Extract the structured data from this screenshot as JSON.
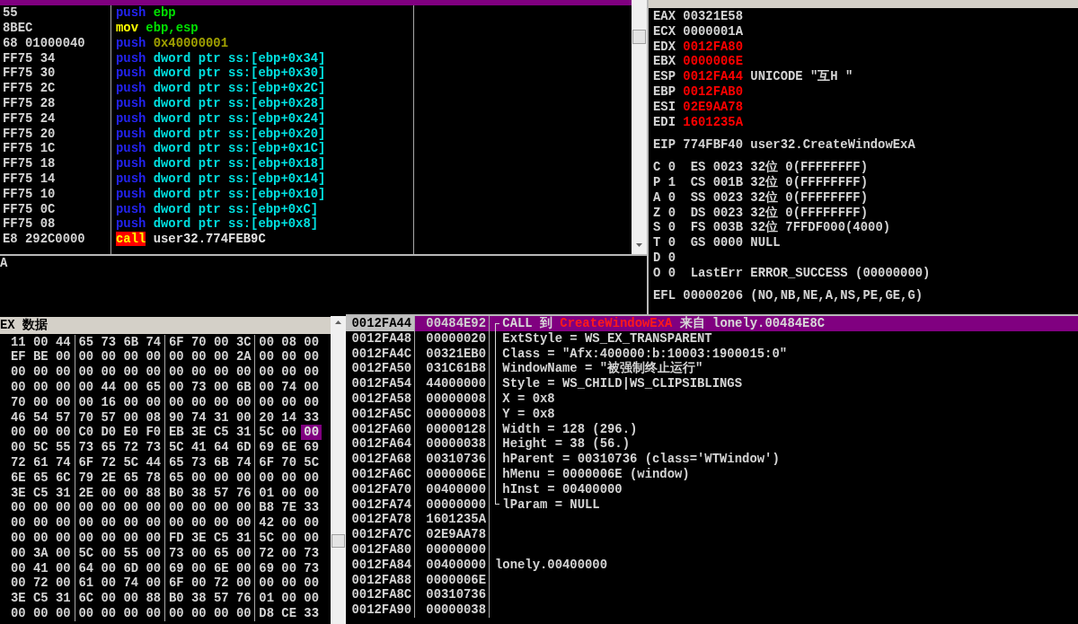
{
  "disassembly": {
    "top_row_selected": true,
    "rows": [
      {
        "bytes": "55",
        "instruction": [
          {
            "text": "push",
            "kind": "push"
          },
          {
            "text": "ebp",
            "kind": "register"
          }
        ]
      },
      {
        "bytes": "8BEC",
        "instruction": [
          {
            "text": "mov",
            "kind": "mov"
          },
          {
            "text": "ebp,esp",
            "kind": "register"
          }
        ]
      },
      {
        "bytes": "68 01000040",
        "instruction": [
          {
            "text": "push",
            "kind": "push"
          },
          {
            "text": "0x40000001",
            "kind": "constant"
          }
        ]
      },
      {
        "bytes": "FF75 34",
        "instruction": [
          {
            "text": "push",
            "kind": "push"
          },
          {
            "text": "dword ptr ss:[ebp+0x34]",
            "kind": "memory"
          }
        ]
      },
      {
        "bytes": "FF75 30",
        "instruction": [
          {
            "text": "push",
            "kind": "push"
          },
          {
            "text": "dword ptr ss:[ebp+0x30]",
            "kind": "memory"
          }
        ]
      },
      {
        "bytes": "FF75 2C",
        "instruction": [
          {
            "text": "push",
            "kind": "push"
          },
          {
            "text": "dword ptr ss:[ebp+0x2C]",
            "kind": "memory"
          }
        ]
      },
      {
        "bytes": "FF75 28",
        "instruction": [
          {
            "text": "push",
            "kind": "push"
          },
          {
            "text": "dword ptr ss:[ebp+0x28]",
            "kind": "memory"
          }
        ]
      },
      {
        "bytes": "FF75 24",
        "instruction": [
          {
            "text": "push",
            "kind": "push"
          },
          {
            "text": "dword ptr ss:[ebp+0x24]",
            "kind": "memory"
          }
        ]
      },
      {
        "bytes": "FF75 20",
        "instruction": [
          {
            "text": "push",
            "kind": "push"
          },
          {
            "text": "dword ptr ss:[ebp+0x20]",
            "kind": "memory"
          }
        ]
      },
      {
        "bytes": "FF75 1C",
        "instruction": [
          {
            "text": "push",
            "kind": "push"
          },
          {
            "text": "dword ptr ss:[ebp+0x1C]",
            "kind": "memory"
          }
        ]
      },
      {
        "bytes": "FF75 18",
        "instruction": [
          {
            "text": "push",
            "kind": "push"
          },
          {
            "text": "dword ptr ss:[ebp+0x18]",
            "kind": "memory"
          }
        ]
      },
      {
        "bytes": "FF75 14",
        "instruction": [
          {
            "text": "push",
            "kind": "push"
          },
          {
            "text": "dword ptr ss:[ebp+0x14]",
            "kind": "memory"
          }
        ]
      },
      {
        "bytes": "FF75 10",
        "instruction": [
          {
            "text": "push",
            "kind": "push"
          },
          {
            "text": "dword ptr ss:[ebp+0x10]",
            "kind": "memory"
          }
        ]
      },
      {
        "bytes": "FF75 0C",
        "instruction": [
          {
            "text": "push",
            "kind": "push"
          },
          {
            "text": "dword ptr ss:[ebp+0xC]",
            "kind": "memory"
          }
        ]
      },
      {
        "bytes": "FF75 08",
        "instruction": [
          {
            "text": "push",
            "kind": "push"
          },
          {
            "text": "dword ptr ss:[ebp+0x8]",
            "kind": "memory"
          }
        ]
      },
      {
        "bytes": "E8 292C0000",
        "instruction": [
          {
            "text": "call",
            "kind": "call"
          },
          {
            "text": "user32.774FEB9C",
            "kind": "address"
          }
        ]
      }
    ]
  },
  "info_pane": {
    "text": "A"
  },
  "registers": {
    "general": [
      {
        "name": "EAX",
        "value": "00321E58",
        "changed": false
      },
      {
        "name": "ECX",
        "value": "0000001A",
        "changed": false
      },
      {
        "name": "EDX",
        "value": "0012FA80",
        "changed": true
      },
      {
        "name": "EBX",
        "value": "0000006E",
        "changed": true
      },
      {
        "name": "ESP",
        "value": "0012FA44",
        "changed": true,
        "comment": "UNICODE \"互H \""
      },
      {
        "name": "EBP",
        "value": "0012FAB0",
        "changed": true
      },
      {
        "name": "ESI",
        "value": "02E9AA78",
        "changed": true
      },
      {
        "name": "EDI",
        "value": "1601235A",
        "changed": true
      }
    ],
    "eip": {
      "name": "EIP",
      "value": "774FBF40",
      "comment": "user32.CreateWindowExA"
    },
    "flags": [
      {
        "flag": "C",
        "value": "0",
        "segment": "ES 0023 32位 0(FFFFFFFF)"
      },
      {
        "flag": "P",
        "value": "1",
        "segment": "CS 001B 32位 0(FFFFFFFF)"
      },
      {
        "flag": "A",
        "value": "0",
        "segment": "SS 0023 32位 0(FFFFFFFF)"
      },
      {
        "flag": "Z",
        "value": "0",
        "segment": "DS 0023 32位 0(FFFFFFFF)"
      },
      {
        "flag": "S",
        "value": "0",
        "segment": "FS 003B 32位 7FFDF000(4000)"
      },
      {
        "flag": "T",
        "value": "0",
        "segment": "GS 0000 NULL"
      },
      {
        "flag": "D",
        "value": "0"
      },
      {
        "flag": "O",
        "value": "0",
        "segment": "LastErr ERROR_SUCCESS (00000000)"
      }
    ],
    "efl": {
      "name": "EFL",
      "value": "00000206",
      "comment": "(NO,NB,NE,A,NS,PE,GE,G)"
    }
  },
  "hex_dump": {
    "title": "EX 数据",
    "rows": [
      {
        "groups": [
          [
            {
              "text": "11",
              "selected": false
            },
            {
              "text": "00",
              "selected": false
            },
            {
              "text": "44",
              "selected": false
            }
          ],
          [
            {
              "text": "65",
              "selected": false
            },
            {
              "text": "73",
              "selected": false
            },
            {
              "text": "6B",
              "selected": false
            },
            {
              "text": "74",
              "selected": false
            }
          ],
          [
            {
              "text": "6F",
              "selected": false
            },
            {
              "text": "70",
              "selected": false
            },
            {
              "text": "00",
              "selected": false
            },
            {
              "text": "3C",
              "selected": false
            }
          ],
          [
            {
              "text": "00",
              "selected": false
            },
            {
              "text": "08",
              "selected": false
            },
            {
              "text": "00",
              "selected": false
            }
          ]
        ]
      },
      {
        "groups": [
          [
            {
              "text": "EF",
              "selected": false
            },
            {
              "text": "BE",
              "selected": false
            },
            {
              "text": "00",
              "selected": false
            }
          ],
          [
            {
              "text": "00",
              "selected": false
            },
            {
              "text": "00",
              "selected": false
            },
            {
              "text": "00",
              "selected": false
            },
            {
              "text": "00",
              "selected": false
            }
          ],
          [
            {
              "text": "00",
              "selected": false
            },
            {
              "text": "00",
              "selected": false
            },
            {
              "text": "00",
              "selected": false
            },
            {
              "text": "2A",
              "selected": false
            }
          ],
          [
            {
              "text": "00",
              "selected": false
            },
            {
              "text": "00",
              "selected": false
            },
            {
              "text": "00",
              "selected": false
            }
          ]
        ]
      },
      {
        "groups": [
          [
            {
              "text": "00",
              "selected": false
            },
            {
              "text": "00",
              "selected": false
            },
            {
              "text": "00",
              "selected": false
            }
          ],
          [
            {
              "text": "00",
              "selected": false
            },
            {
              "text": "00",
              "selected": false
            },
            {
              "text": "00",
              "selected": false
            },
            {
              "text": "00",
              "selected": false
            }
          ],
          [
            {
              "text": "00",
              "selected": false
            },
            {
              "text": "00",
              "selected": false
            },
            {
              "text": "00",
              "selected": false
            },
            {
              "text": "00",
              "selected": false
            }
          ],
          [
            {
              "text": "00",
              "selected": false
            },
            {
              "text": "00",
              "selected": false
            },
            {
              "text": "00",
              "selected": false
            }
          ]
        ]
      },
      {
        "groups": [
          [
            {
              "text": "00",
              "selected": false
            },
            {
              "text": "00",
              "selected": false
            },
            {
              "text": "00",
              "selected": false
            }
          ],
          [
            {
              "text": "00",
              "selected": false
            },
            {
              "text": "44",
              "selected": false
            },
            {
              "text": "00",
              "selected": false
            },
            {
              "text": "65",
              "selected": false
            }
          ],
          [
            {
              "text": "00",
              "selected": false
            },
            {
              "text": "73",
              "selected": false
            },
            {
              "text": "00",
              "selected": false
            },
            {
              "text": "6B",
              "selected": false
            }
          ],
          [
            {
              "text": "00",
              "selected": false
            },
            {
              "text": "74",
              "selected": false
            },
            {
              "text": "00",
              "selected": false
            }
          ]
        ]
      },
      {
        "groups": [
          [
            {
              "text": "70",
              "selected": false
            },
            {
              "text": "00",
              "selected": false
            },
            {
              "text": "00",
              "selected": false
            }
          ],
          [
            {
              "text": "00",
              "selected": false
            },
            {
              "text": "16",
              "selected": false
            },
            {
              "text": "00",
              "selected": false
            },
            {
              "text": "00",
              "selected": false
            }
          ],
          [
            {
              "text": "00",
              "selected": false
            },
            {
              "text": "00",
              "selected": false
            },
            {
              "text": "00",
              "selected": false
            },
            {
              "text": "00",
              "selected": false
            }
          ],
          [
            {
              "text": "00",
              "selected": false
            },
            {
              "text": "00",
              "selected": false
            },
            {
              "text": "00",
              "selected": false
            }
          ]
        ]
      },
      {
        "groups": [
          [
            {
              "text": "46",
              "selected": false
            },
            {
              "text": "54",
              "selected": false
            },
            {
              "text": "57",
              "selected": false
            }
          ],
          [
            {
              "text": "70",
              "selected": false
            },
            {
              "text": "57",
              "selected": false
            },
            {
              "text": "00",
              "selected": false
            },
            {
              "text": "08",
              "selected": false
            }
          ],
          [
            {
              "text": "90",
              "selected": false
            },
            {
              "text": "74",
              "selected": false
            },
            {
              "text": "31",
              "selected": false
            },
            {
              "text": "00",
              "selected": false
            }
          ],
          [
            {
              "text": "20",
              "selected": false
            },
            {
              "text": "14",
              "selected": false
            },
            {
              "text": "33",
              "selected": false
            }
          ]
        ]
      },
      {
        "groups": [
          [
            {
              "text": "00",
              "selected": false
            },
            {
              "text": "00",
              "selected": false
            },
            {
              "text": "00",
              "selected": false
            }
          ],
          [
            {
              "text": "C0",
              "selected": false
            },
            {
              "text": "D0",
              "selected": false
            },
            {
              "text": "E0",
              "selected": false
            },
            {
              "text": "F0",
              "selected": false
            }
          ],
          [
            {
              "text": "EB",
              "selected": false
            },
            {
              "text": "3E",
              "selected": false
            },
            {
              "text": "C5",
              "selected": false
            },
            {
              "text": "31",
              "selected": false
            }
          ],
          [
            {
              "text": "5C",
              "selected": false
            },
            {
              "text": "00",
              "selected": false
            },
            {
              "text": "00",
              "selected": true
            }
          ]
        ]
      },
      {
        "groups": [
          [
            {
              "text": "00",
              "selected": false
            },
            {
              "text": "5C",
              "selected": false
            },
            {
              "text": "55",
              "selected": false
            }
          ],
          [
            {
              "text": "73",
              "selected": false
            },
            {
              "text": "65",
              "selected": false
            },
            {
              "text": "72",
              "selected": false
            },
            {
              "text": "73",
              "selected": false
            }
          ],
          [
            {
              "text": "5C",
              "selected": false
            },
            {
              "text": "41",
              "selected": false
            },
            {
              "text": "64",
              "selected": false
            },
            {
              "text": "6D",
              "selected": false
            }
          ],
          [
            {
              "text": "69",
              "selected": false
            },
            {
              "text": "6E",
              "selected": false
            },
            {
              "text": "69",
              "selected": false
            }
          ]
        ]
      },
      {
        "groups": [
          [
            {
              "text": "72",
              "selected": false
            },
            {
              "text": "61",
              "selected": false
            },
            {
              "text": "74",
              "selected": false
            }
          ],
          [
            {
              "text": "6F",
              "selected": false
            },
            {
              "text": "72",
              "selected": false
            },
            {
              "text": "5C",
              "selected": false
            },
            {
              "text": "44",
              "selected": false
            }
          ],
          [
            {
              "text": "65",
              "selected": false
            },
            {
              "text": "73",
              "selected": false
            },
            {
              "text": "6B",
              "selected": false
            },
            {
              "text": "74",
              "selected": false
            }
          ],
          [
            {
              "text": "6F",
              "selected": false
            },
            {
              "text": "70",
              "selected": false
            },
            {
              "text": "5C",
              "selected": false
            }
          ]
        ]
      },
      {
        "groups": [
          [
            {
              "text": "6E",
              "selected": false
            },
            {
              "text": "65",
              "selected": false
            },
            {
              "text": "6C",
              "selected": false
            }
          ],
          [
            {
              "text": "79",
              "selected": false
            },
            {
              "text": "2E",
              "selected": false
            },
            {
              "text": "65",
              "selected": false
            },
            {
              "text": "78",
              "selected": false
            }
          ],
          [
            {
              "text": "65",
              "selected": false
            },
            {
              "text": "00",
              "selected": false
            },
            {
              "text": "00",
              "selected": false
            },
            {
              "text": "00",
              "selected": false
            }
          ],
          [
            {
              "text": "00",
              "selected": false
            },
            {
              "text": "00",
              "selected": false
            },
            {
              "text": "00",
              "selected": false
            }
          ]
        ]
      },
      {
        "groups": [
          [
            {
              "text": "3E",
              "selected": false
            },
            {
              "text": "C5",
              "selected": false
            },
            {
              "text": "31",
              "selected": false
            }
          ],
          [
            {
              "text": "2E",
              "selected": false
            },
            {
              "text": "00",
              "selected": false
            },
            {
              "text": "00",
              "selected": false
            },
            {
              "text": "88",
              "selected": false
            }
          ],
          [
            {
              "text": "B0",
              "selected": false
            },
            {
              "text": "38",
              "selected": false
            },
            {
              "text": "57",
              "selected": false
            },
            {
              "text": "76",
              "selected": false
            }
          ],
          [
            {
              "text": "01",
              "selected": false
            },
            {
              "text": "00",
              "selected": false
            },
            {
              "text": "00",
              "selected": false
            }
          ]
        ]
      },
      {
        "groups": [
          [
            {
              "text": "00",
              "selected": false
            },
            {
              "text": "00",
              "selected": false
            },
            {
              "text": "00",
              "selected": false
            }
          ],
          [
            {
              "text": "00",
              "selected": false
            },
            {
              "text": "00",
              "selected": false
            },
            {
              "text": "00",
              "selected": false
            },
            {
              "text": "00",
              "selected": false
            }
          ],
          [
            {
              "text": "00",
              "selected": false
            },
            {
              "text": "00",
              "selected": false
            },
            {
              "text": "00",
              "selected": false
            },
            {
              "text": "00",
              "selected": false
            }
          ],
          [
            {
              "text": "B8",
              "selected": false
            },
            {
              "text": "7E",
              "selected": false
            },
            {
              "text": "33",
              "selected": false
            }
          ]
        ]
      },
      {
        "groups": [
          [
            {
              "text": "00",
              "selected": false
            },
            {
              "text": "00",
              "selected": false
            },
            {
              "text": "00",
              "selected": false
            }
          ],
          [
            {
              "text": "00",
              "selected": false
            },
            {
              "text": "00",
              "selected": false
            },
            {
              "text": "00",
              "selected": false
            },
            {
              "text": "00",
              "selected": false
            }
          ],
          [
            {
              "text": "00",
              "selected": false
            },
            {
              "text": "00",
              "selected": false
            },
            {
              "text": "00",
              "selected": false
            },
            {
              "text": "00",
              "selected": false
            }
          ],
          [
            {
              "text": "42",
              "selected": false
            },
            {
              "text": "00",
              "selected": false
            },
            {
              "text": "00",
              "selected": false
            }
          ]
        ]
      },
      {
        "groups": [
          [
            {
              "text": "00",
              "selected": false
            },
            {
              "text": "00",
              "selected": false
            },
            {
              "text": "00",
              "selected": false
            }
          ],
          [
            {
              "text": "00",
              "selected": false
            },
            {
              "text": "00",
              "selected": false
            },
            {
              "text": "00",
              "selected": false
            },
            {
              "text": "00",
              "selected": false
            }
          ],
          [
            {
              "text": "FD",
              "selected": false
            },
            {
              "text": "3E",
              "selected": false
            },
            {
              "text": "C5",
              "selected": false
            },
            {
              "text": "31",
              "selected": false
            }
          ],
          [
            {
              "text": "5C",
              "selected": false
            },
            {
              "text": "00",
              "selected": false
            },
            {
              "text": "00",
              "selected": false
            }
          ]
        ]
      },
      {
        "groups": [
          [
            {
              "text": "00",
              "selected": false
            },
            {
              "text": "3A",
              "selected": false
            },
            {
              "text": "00",
              "selected": false
            }
          ],
          [
            {
              "text": "5C",
              "selected": false
            },
            {
              "text": "00",
              "selected": false
            },
            {
              "text": "55",
              "selected": false
            },
            {
              "text": "00",
              "selected": false
            }
          ],
          [
            {
              "text": "73",
              "selected": false
            },
            {
              "text": "00",
              "selected": false
            },
            {
              "text": "65",
              "selected": false
            },
            {
              "text": "00",
              "selected": false
            }
          ],
          [
            {
              "text": "72",
              "selected": false
            },
            {
              "text": "00",
              "selected": false
            },
            {
              "text": "73",
              "selected": false
            }
          ]
        ]
      },
      {
        "groups": [
          [
            {
              "text": "00",
              "selected": false
            },
            {
              "text": "41",
              "selected": false
            },
            {
              "text": "00",
              "selected": false
            }
          ],
          [
            {
              "text": "64",
              "selected": false
            },
            {
              "text": "00",
              "selected": false
            },
            {
              "text": "6D",
              "selected": false
            },
            {
              "text": "00",
              "selected": false
            }
          ],
          [
            {
              "text": "69",
              "selected": false
            },
            {
              "text": "00",
              "selected": false
            },
            {
              "text": "6E",
              "selected": false
            },
            {
              "text": "00",
              "selected": false
            }
          ],
          [
            {
              "text": "69",
              "selected": false
            },
            {
              "text": "00",
              "selected": false
            },
            {
              "text": "73",
              "selected": false
            }
          ]
        ]
      },
      {
        "groups": [
          [
            {
              "text": "00",
              "selected": false
            },
            {
              "text": "72",
              "selected": false
            },
            {
              "text": "00",
              "selected": false
            }
          ],
          [
            {
              "text": "61",
              "selected": false
            },
            {
              "text": "00",
              "selected": false
            },
            {
              "text": "74",
              "selected": false
            },
            {
              "text": "00",
              "selected": false
            }
          ],
          [
            {
              "text": "6F",
              "selected": false
            },
            {
              "text": "00",
              "selected": false
            },
            {
              "text": "72",
              "selected": false
            },
            {
              "text": "00",
              "selected": false
            }
          ],
          [
            {
              "text": "00",
              "selected": false
            },
            {
              "text": "00",
              "selected": false
            },
            {
              "text": "00",
              "selected": false
            }
          ]
        ]
      },
      {
        "groups": [
          [
            {
              "text": "3E",
              "selected": false
            },
            {
              "text": "C5",
              "selected": false
            },
            {
              "text": "31",
              "selected": false
            }
          ],
          [
            {
              "text": "6C",
              "selected": false
            },
            {
              "text": "00",
              "selected": false
            },
            {
              "text": "00",
              "selected": false
            },
            {
              "text": "88",
              "selected": false
            }
          ],
          [
            {
              "text": "B0",
              "selected": false
            },
            {
              "text": "38",
              "selected": false
            },
            {
              "text": "57",
              "selected": false
            },
            {
              "text": "76",
              "selected": false
            }
          ],
          [
            {
              "text": "01",
              "selected": false
            },
            {
              "text": "00",
              "selected": false
            },
            {
              "text": "00",
              "selected": false
            }
          ]
        ]
      },
      {
        "groups": [
          [
            {
              "text": "00",
              "selected": false
            },
            {
              "text": "00",
              "selected": false
            },
            {
              "text": "00",
              "selected": false
            }
          ],
          [
            {
              "text": "00",
              "selected": false
            },
            {
              "text": "00",
              "selected": false
            },
            {
              "text": "00",
              "selected": false
            },
            {
              "text": "00",
              "selected": false
            }
          ],
          [
            {
              "text": "00",
              "selected": false
            },
            {
              "text": "00",
              "selected": false
            },
            {
              "text": "00",
              "selected": false
            },
            {
              "text": "00",
              "selected": false
            }
          ],
          [
            {
              "text": "D8",
              "selected": false
            },
            {
              "text": "CE",
              "selected": false
            },
            {
              "text": "33",
              "selected": false
            }
          ]
        ]
      }
    ]
  },
  "stack": {
    "rows": [
      {
        "address": "0012FA44",
        "value": "00484E92",
        "selected": true,
        "in_call_frame": true,
        "comment_parts": [
          {
            "text": "CALL 到",
            "kind": "plain"
          },
          {
            "text": "CreateWindowExA",
            "kind": "function"
          },
          {
            "text": "来自 lonely.00484E8C",
            "kind": "plain"
          }
        ]
      },
      {
        "address": "0012FA48",
        "value": "00000020",
        "selected": false,
        "in_call_frame": true,
        "comment": "ExtStyle = WS_EX_TRANSPARENT"
      },
      {
        "address": "0012FA4C",
        "value": "00321EB0",
        "selected": false,
        "in_call_frame": true,
        "comment": "Class = \"Afx:400000:b:10003:1900015:0\""
      },
      {
        "address": "0012FA50",
        "value": "031C61B8",
        "selected": false,
        "in_call_frame": true,
        "comment": "WindowName = \"被强制终止运行\""
      },
      {
        "address": "0012FA54",
        "value": "44000000",
        "selected": false,
        "in_call_frame": true,
        "comment": "Style = WS_CHILD|WS_CLIPSIBLINGS"
      },
      {
        "address": "0012FA58",
        "value": "00000008",
        "selected": false,
        "in_call_frame": true,
        "comment": "X = 0x8"
      },
      {
        "address": "0012FA5C",
        "value": "00000008",
        "selected": false,
        "in_call_frame": true,
        "comment": "Y = 0x8"
      },
      {
        "address": "0012FA60",
        "value": "00000128",
        "selected": false,
        "in_call_frame": true,
        "comment": "Width = 128 (296.)"
      },
      {
        "address": "0012FA64",
        "value": "00000038",
        "selected": false,
        "in_call_frame": true,
        "comment": "Height = 38 (56.)"
      },
      {
        "address": "0012FA68",
        "value": "00310736",
        "selected": false,
        "in_call_frame": true,
        "comment": "hParent = 00310736 (class='WTWindow')"
      },
      {
        "address": "0012FA6C",
        "value": "0000006E",
        "selected": false,
        "in_call_frame": true,
        "comment": "hMenu = 0000006E (window)"
      },
      {
        "address": "0012FA70",
        "value": "00400000",
        "selected": false,
        "in_call_frame": true,
        "comment": "hInst = 00400000"
      },
      {
        "address": "0012FA74",
        "value": "00000000",
        "selected": false,
        "in_call_frame": true,
        "comment": "lParam = NULL"
      },
      {
        "address": "0012FA78",
        "value": "1601235A",
        "selected": false,
        "in_call_frame": false
      },
      {
        "address": "0012FA7C",
        "value": "02E9AA78",
        "selected": false,
        "in_call_frame": false
      },
      {
        "address": "0012FA80",
        "value": "00000000",
        "selected": false,
        "in_call_frame": false
      },
      {
        "address": "0012FA84",
        "value": "00400000",
        "selected": false,
        "in_call_frame": false,
        "comment": "lonely.00400000"
      },
      {
        "address": "0012FA88",
        "value": "0000006E",
        "selected": false,
        "in_call_frame": false
      },
      {
        "address": "0012FA8C",
        "value": "00310736",
        "selected": false,
        "in_call_frame": false
      },
      {
        "address": "0012FA90",
        "value": "00000038",
        "selected": false,
        "in_call_frame": false
      }
    ]
  }
}
